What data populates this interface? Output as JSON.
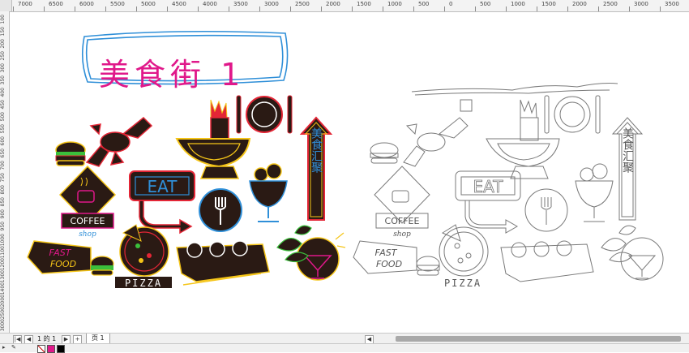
{
  "ruler": {
    "top_labels": [
      "7000",
      "6500",
      "6000",
      "5500",
      "5000",
      "4500",
      "4000",
      "3500",
      "3000",
      "2500",
      "2000",
      "1500",
      "1000",
      "500",
      "0",
      "500",
      "1000",
      "1500",
      "2000",
      "2500",
      "3000",
      "3500"
    ],
    "left_labels": [
      "100",
      "150",
      "200",
      "250",
      "300",
      "350",
      "400",
      "450",
      "500",
      "550",
      "600",
      "650",
      "700",
      "750",
      "800",
      "850",
      "900",
      "950",
      "1000",
      "1100",
      "1200",
      "1300",
      "1400",
      "2000",
      "2500",
      "3000"
    ]
  },
  "canvas": {
    "title_text": "美食街 1",
    "neon_signs": {
      "coffee_label": "COFFEE",
      "coffee_sub": "shop",
      "eat_label": "EAT",
      "fast_food_line1": "FAST",
      "fast_food_line2": "FOOD",
      "pizza_label": "PIZZA",
      "arrow_label": "美食汇聚"
    },
    "outline_signs": {
      "coffee_label": "COFFEE",
      "coffee_sub": "shop",
      "eat_label": "EAT",
      "fast_food_line1": "FAST",
      "fast_food_line2": "FOOD",
      "pizza_label": "PIZZA",
      "arrow_label": "美食汇聚"
    }
  },
  "page_nav": {
    "first": "|◀",
    "prev": "◀",
    "page_indicator": "1 的 1",
    "next": "▶",
    "last": "▶|",
    "add_page": "+",
    "page_tab": "页 1"
  },
  "colors": {
    "neon_pink": "#e0188a",
    "neon_yellow": "#f5c518",
    "neon_blue": "#2f8fd8",
    "neon_red": "#e32636",
    "neon_green": "#3bbf3b",
    "sign_dark": "#2a1a14",
    "outline": "#7a7a7a"
  },
  "status": {
    "swatches": [
      "#ffffff",
      "#e0188a",
      "#000000"
    ]
  }
}
